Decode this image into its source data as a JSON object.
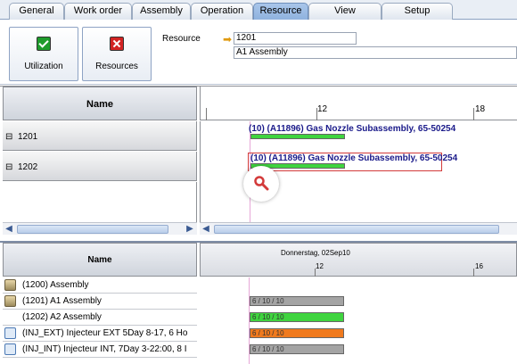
{
  "tabs": [
    "General",
    "Work order",
    "Assembly",
    "Operation",
    "Resource",
    "View",
    "Setup"
  ],
  "active_tab": "Resource",
  "toolbar": {
    "utilization_label": "Utilization",
    "resources_label": "Resources",
    "resource_label": "Resource",
    "resource_value": "1201",
    "resource_desc": "A1 Assembly"
  },
  "upper": {
    "name_header": "Name",
    "rows": [
      "1201",
      "1202"
    ],
    "ticks": [
      "12",
      "18"
    ],
    "bars": [
      {
        "label": "(10) (A11896) Gas Nozzle Subassembly, 65-50254"
      },
      {
        "label": "(10) (A11896) Gas Nozzle Subassembly, 65-50254"
      }
    ]
  },
  "lower": {
    "name_header": "Name",
    "date_header": "Donnerstag, 02Sep10",
    "ticks": [
      "12",
      "16"
    ],
    "rows": [
      {
        "label": "(1200) Assembly",
        "bar": ""
      },
      {
        "label": "(1201) A1 Assembly",
        "bar": "6 / 10 / 10"
      },
      {
        "label": "(1202) A2 Assembly",
        "bar": "6 / 10 / 10"
      },
      {
        "label": "(INJ_EXT) Injecteur EXT 5Day 8-17, 6 Ho",
        "bar": "6 / 10 / 10"
      },
      {
        "label": "(INJ_INT) Injecteur INT, 7Day 3-22:00, 8 I",
        "bar": "6 / 10 / 10"
      }
    ]
  },
  "colors": {
    "green": "#3fd43f",
    "orange": "#f07a1e",
    "gray": "#a4a4a4",
    "selection": "#d33a3a"
  }
}
